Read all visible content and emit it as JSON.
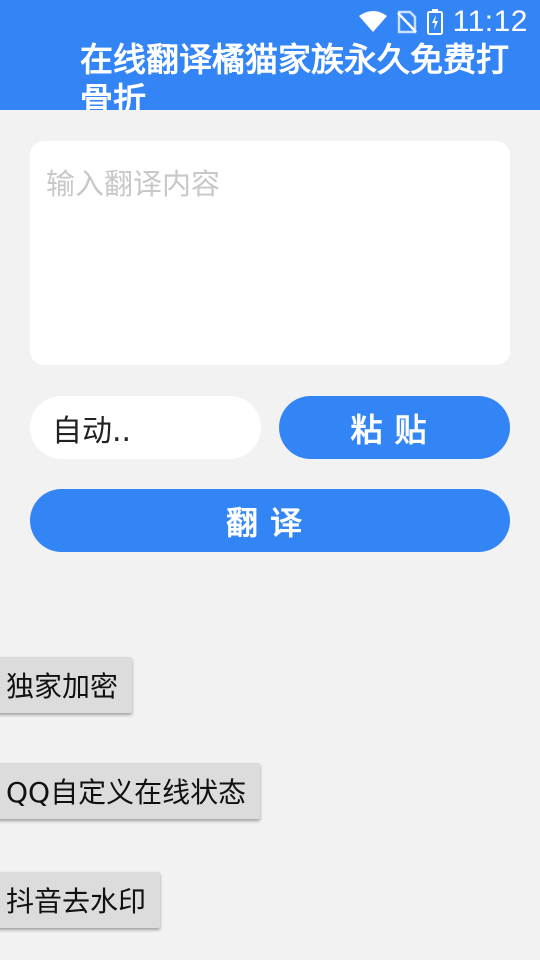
{
  "status_bar": {
    "time": "11:12",
    "icons": [
      "wifi-icon",
      "no-sim-icon",
      "battery-icon"
    ]
  },
  "header": {
    "title": "在线翻译橘猫家族永久免费打骨折"
  },
  "input": {
    "value": "",
    "placeholder": "输入翻译内容"
  },
  "language_select": {
    "selected": "自动.."
  },
  "buttons": {
    "paste_label": "粘贴",
    "translate_label": "翻译",
    "exclusive_encrypt_label": "独家加密",
    "qq_status_label": "QQ自定义在线状态",
    "douyin_watermark_label": "抖音去水印"
  },
  "colors": {
    "primary": "#3385f6",
    "background": "#f2f2f2",
    "card": "#ffffff",
    "side_button": "#dcdcdc"
  }
}
